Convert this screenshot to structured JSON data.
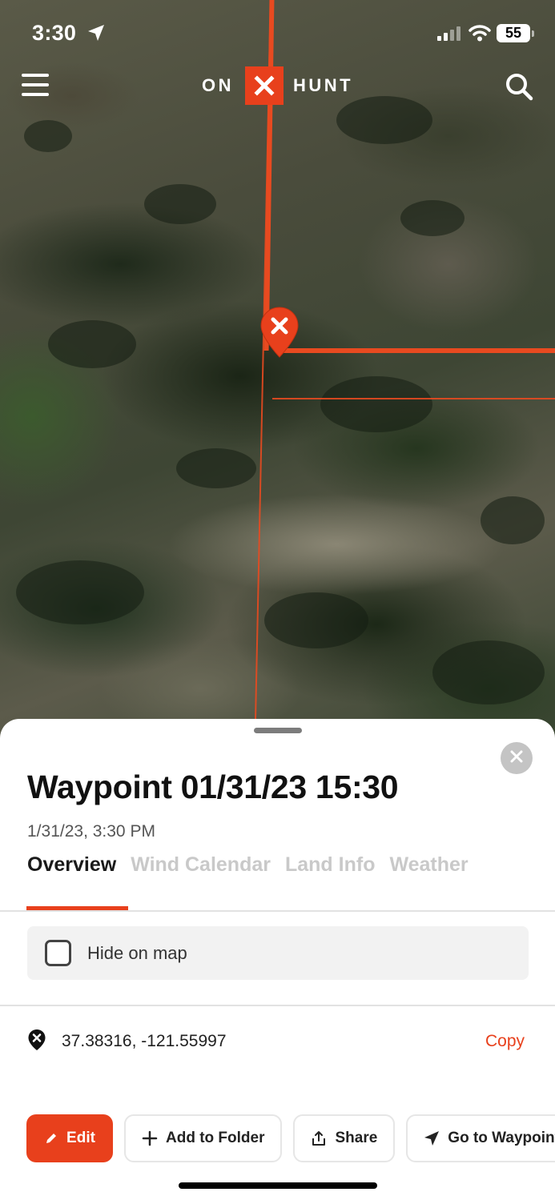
{
  "status_bar": {
    "time": "3:30",
    "battery": "55"
  },
  "header": {
    "logo_left": "ON",
    "logo_right": "HUNT"
  },
  "colors": {
    "accent": "#e8401c",
    "boundary": "#e84a20"
  },
  "waypoint": {
    "title": "Waypoint 01/31/23 15:30",
    "datetime": "1/31/23, 3:30 PM",
    "tabs": [
      {
        "label": "Overview",
        "active": true
      },
      {
        "label": "Wind Calendar",
        "active": false
      },
      {
        "label": "Land Info",
        "active": false
      },
      {
        "label": "Weather",
        "active": false
      }
    ],
    "hide_on_map_label": "Hide on map",
    "hide_on_map_checked": false,
    "coordinates": "37.38316, -121.55997",
    "copy_label": "Copy"
  },
  "actions": {
    "edit": "Edit",
    "add_to_folder": "Add to Folder",
    "share": "Share",
    "go_to_waypoint": "Go to Waypoint"
  },
  "icons": [
    "location-arrow-icon",
    "signal-icon",
    "wifi-icon",
    "battery-icon",
    "menu-icon",
    "logo-x-icon",
    "search-icon",
    "waypoint-pin-icon",
    "close-icon",
    "coordinates-pin-icon",
    "pencil-icon",
    "plus-icon",
    "share-icon",
    "navigate-icon"
  ]
}
